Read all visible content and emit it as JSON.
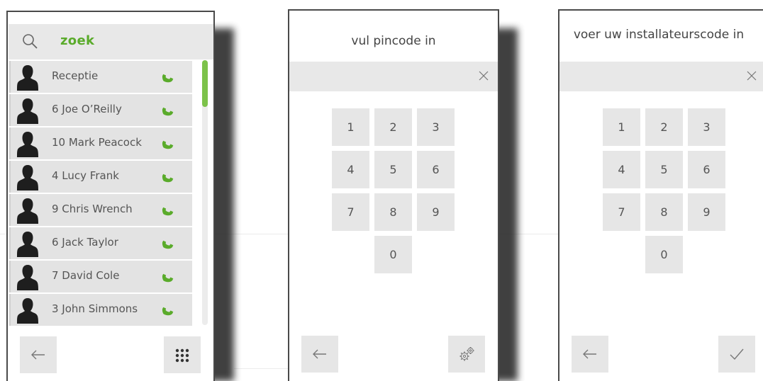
{
  "directory": {
    "search_label": "zoek",
    "accent_color": "#5aab2b",
    "contacts": [
      {
        "name": "Receptie"
      },
      {
        "name": "6 Joe O’Reilly"
      },
      {
        "name": "10 Mark Peacock"
      },
      {
        "name": "4 Lucy Frank"
      },
      {
        "name": "9 Chris Wrench"
      },
      {
        "name": "6 Jack Taylor"
      },
      {
        "name": "7 David Cole"
      },
      {
        "name": "3 John Simmons"
      }
    ],
    "icons": {
      "search": "search-icon",
      "avatar": "person-silhouette-icon",
      "call": "phone-handset-icon",
      "back": "arrow-left-icon",
      "keypad": "keypad-grid-icon"
    }
  },
  "pincode": {
    "title": "vul pincode in",
    "keys": [
      "1",
      "2",
      "3",
      "4",
      "5",
      "6",
      "7",
      "8",
      "9",
      "0"
    ],
    "icons": {
      "clear": "close-icon",
      "back": "arrow-left-icon",
      "settings": "gears-icon"
    }
  },
  "installer": {
    "title": "voer uw installateurscode in",
    "keys": [
      "1",
      "2",
      "3",
      "4",
      "5",
      "6",
      "7",
      "8",
      "9",
      "0"
    ],
    "icons": {
      "clear": "close-icon",
      "back": "arrow-left-icon",
      "confirm": "checkmark-icon"
    }
  }
}
